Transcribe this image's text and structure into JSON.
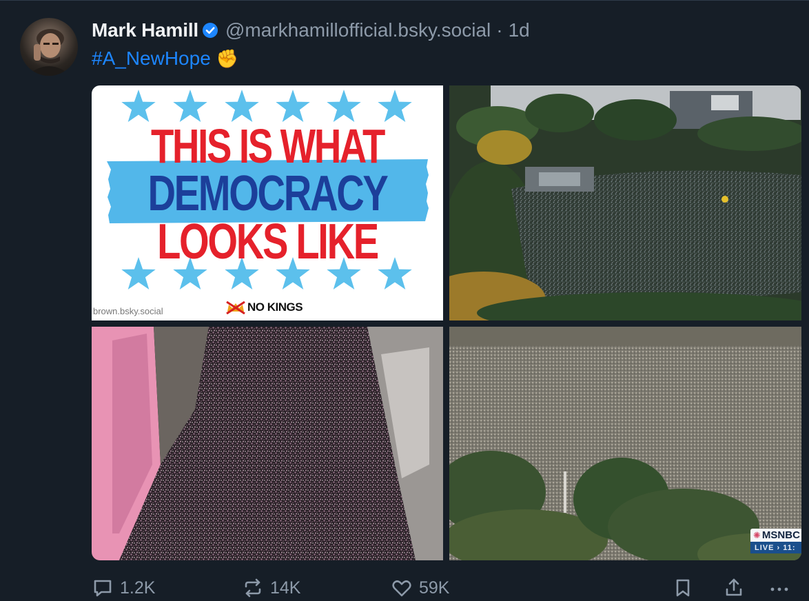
{
  "post": {
    "author": {
      "display_name": "Mark Hamill",
      "handle": "@markhamillofficial.bsky.social",
      "verified": true
    },
    "separator": "·",
    "timestamp": "1d",
    "text": "#A_NewHope",
    "emoji": "✊",
    "images": [
      {
        "alt": "poster",
        "lines": [
          "THIS IS WHAT",
          "DEMOCRACY",
          "LOOKS LIKE"
        ],
        "watermark": "brown.bsky.social",
        "brand": "NO KINGS"
      },
      {
        "alt": "aerial crowd around stage"
      },
      {
        "alt": "crowd filling city street"
      },
      {
        "alt": "aerial crowd in park",
        "network_logo": "MSNBC",
        "live_label": "LIVE › 11:"
      }
    ],
    "actions": {
      "replies": "1.2K",
      "reposts": "14K",
      "likes": "59K"
    }
  },
  "colors": {
    "background": "#161e27",
    "link": "#1d86ff",
    "muted": "#8d9aa9",
    "verified": "#1d86ff",
    "poster_red": "#e5212b",
    "poster_blue": "#1c3f9a",
    "poster_stripe": "#52b7ea",
    "poster_star": "#5cc0ec"
  },
  "icons": {
    "reply": "speech-bubble-icon",
    "repost": "repost-arrows-icon",
    "like": "heart-icon",
    "save": "bookmark-icon",
    "share": "share-upload-icon",
    "more": "ellipsis-icon",
    "verified": "verified-check-icon"
  }
}
